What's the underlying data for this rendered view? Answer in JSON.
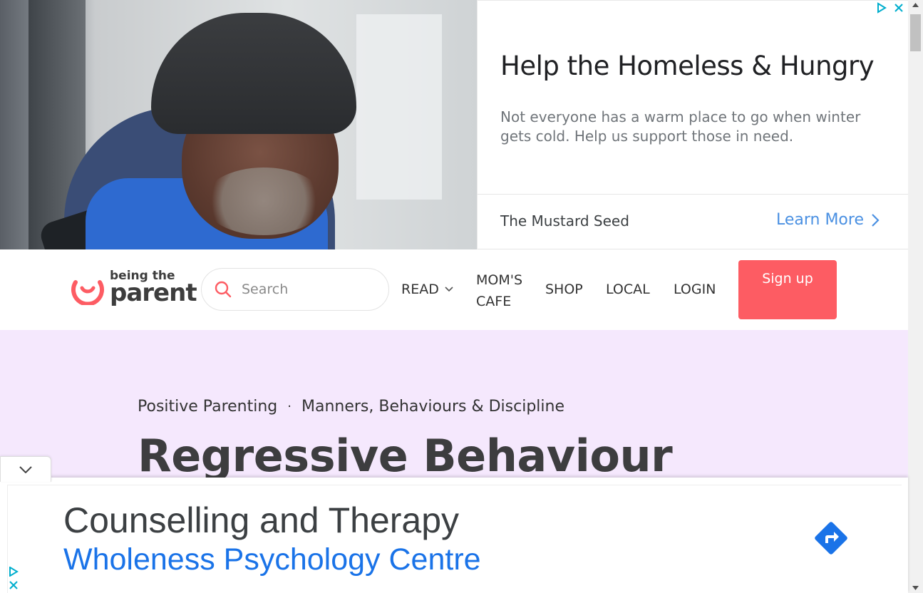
{
  "top_ad": {
    "headline": "Help the Homeless & Hungry",
    "body": "Not everyone has a warm place to go when winter gets cold. Help us support those in need.",
    "advertiser": "The Mustard Seed",
    "cta": "Learn More",
    "accent_color": "#4a90e2"
  },
  "header": {
    "logo_small": "being the",
    "logo_big": "parent",
    "search_placeholder": "Search",
    "nav": {
      "read": "READ",
      "cafe": "MOM'S CAFE",
      "shop": "SHOP",
      "local": "LOCAL",
      "login": "LOGIN"
    },
    "signup": "Sign up",
    "signup_color": "#fd5c63"
  },
  "hero": {
    "breadcrumb": [
      "Positive Parenting",
      "Manners, Behaviours & Discipline"
    ],
    "separator": "·",
    "title": "Regressive Behaviour",
    "background": "#f5e8fd"
  },
  "bottom_ad": {
    "headline": "Counselling and Therapy",
    "advertiser": "Wholeness Psychology Centre",
    "link_color": "#1a73e8"
  }
}
